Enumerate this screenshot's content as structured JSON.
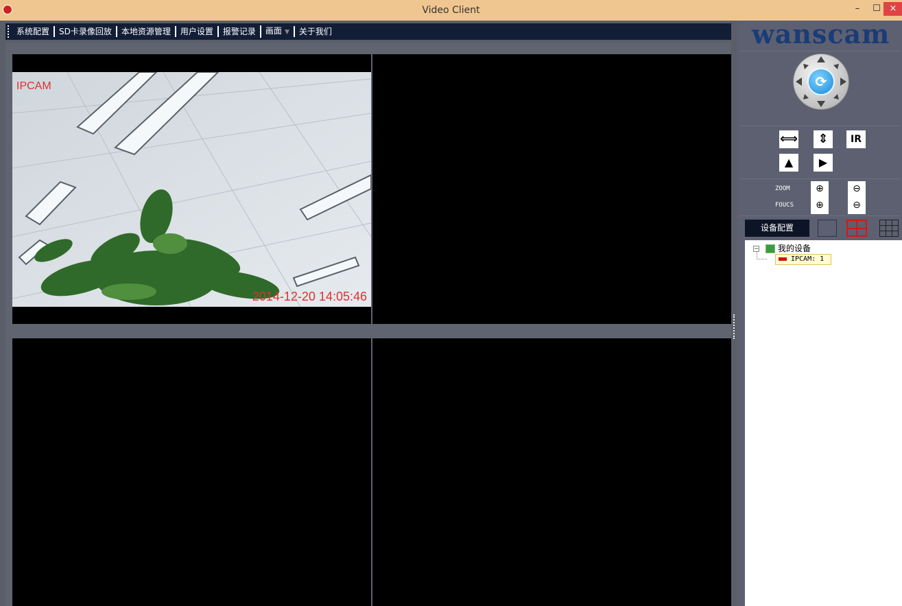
{
  "window": {
    "title": "Video Client",
    "minimize": "–",
    "maximize": "☐",
    "close": "×"
  },
  "menu": [
    {
      "label": "系统配置"
    },
    {
      "label": "SD卡录像回放"
    },
    {
      "label": "本地资源管理"
    },
    {
      "label": "用户设置"
    },
    {
      "label": "报警记录"
    },
    {
      "label": "画面",
      "has_dropdown": true
    },
    {
      "label": "关于我们"
    }
  ],
  "video": {
    "cells": [
      {
        "index": 1,
        "active": true,
        "label": "IPCAM",
        "timestamp": "2014-12-20 14:05:46"
      },
      {
        "index": 2,
        "active": false
      },
      {
        "index": 3,
        "active": false
      },
      {
        "index": 4,
        "active": false
      }
    ]
  },
  "panel": {
    "brand": "wanscam",
    "ptz_center_icon": "refresh-icon",
    "controls": {
      "hflip": "⟺",
      "vflip": "⇕",
      "ir": "IR",
      "mirror": "▲",
      "play": "▶"
    },
    "zoom_label": "ZOOM",
    "focus_label": "FOUCS",
    "zoom_in": "⊕",
    "zoom_out": "⊖",
    "device_config": "设备配置"
  },
  "tree": {
    "root": "我的设备",
    "devices": [
      {
        "label": "IPCAM: 1"
      }
    ]
  }
}
